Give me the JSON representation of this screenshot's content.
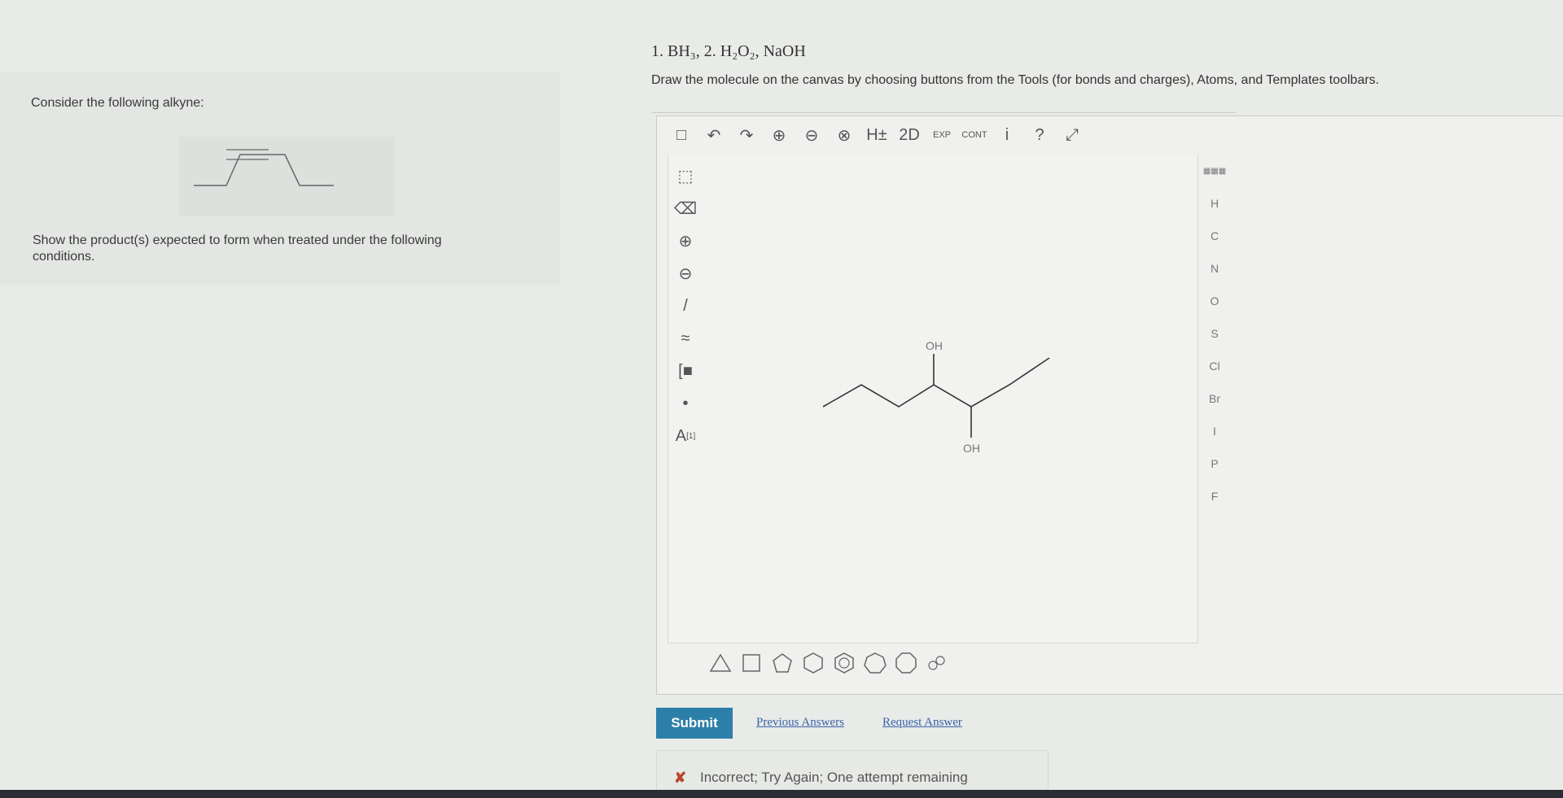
{
  "problem": {
    "consider_label": "Consider the following alkyne:",
    "show_label": "Show the product(s) expected to form when treated under the following conditions."
  },
  "reagents": "1. BH₃, 2. H₂O₂, NaOH",
  "instructions": "Draw the molecule on the canvas by choosing buttons from the Tools (for bonds and charges), Atoms, and Templates toolbars.",
  "editor": {
    "top_toolbar": [
      {
        "icon": "new-document-icon",
        "glyph": "□"
      },
      {
        "icon": "undo-icon",
        "glyph": "↶"
      },
      {
        "icon": "redo-icon",
        "glyph": "↷"
      },
      {
        "icon": "zoom-in-icon",
        "glyph": "⊕"
      },
      {
        "icon": "zoom-out-icon",
        "glyph": "⊖"
      },
      {
        "icon": "zoom-reset-icon",
        "glyph": "⊗"
      },
      {
        "icon": "hydrogen-toggle-icon",
        "glyph": "H±"
      },
      {
        "icon": "2d-clean-icon",
        "glyph": "2D"
      },
      {
        "icon": "expand-icon",
        "glyph": "EXP"
      },
      {
        "icon": "contract-icon",
        "glyph": "CONT"
      },
      {
        "icon": "info-icon",
        "glyph": "i"
      },
      {
        "icon": "help-icon",
        "glyph": "?"
      },
      {
        "icon": "fullscreen-icon",
        "glyph": "⤢"
      }
    ],
    "left_toolbar": [
      {
        "icon": "select-tool-icon",
        "glyph": "⬚"
      },
      {
        "icon": "eraser-icon",
        "glyph": "⌫"
      },
      {
        "icon": "positive-charge-icon",
        "glyph": "⊕"
      },
      {
        "icon": "negative-charge-icon",
        "glyph": "⊖"
      },
      {
        "icon": "single-bond-icon",
        "glyph": "/"
      },
      {
        "icon": "chain-tool-icon",
        "glyph": "≈"
      },
      {
        "icon": "bracket-tool-icon",
        "glyph": "[■"
      },
      {
        "icon": "radical-icon",
        "glyph": "•"
      },
      {
        "icon": "atom-label-icon",
        "glyph": "A"
      }
    ],
    "atom_label_tool_superscript": "[1]",
    "atoms": [
      "H",
      "C",
      "N",
      "O",
      "S",
      "Cl",
      "Br",
      "I",
      "P",
      "F"
    ],
    "periodic_table_icon": "periodic-table-icon",
    "molecule_labels": {
      "oh_top": "OH",
      "oh_bottom": "OH"
    },
    "templates": [
      "triangle",
      "square",
      "pentagon",
      "hexagon",
      "hexagon-aromatic",
      "heptagon",
      "octagon",
      "template-more"
    ]
  },
  "submit_label": "Submit",
  "links": {
    "previous": "Previous Answers",
    "request": "Request Answer"
  },
  "feedback": "Incorrect; Try Again; One attempt remaining",
  "colors": {
    "submit": "#2c7fa8",
    "link": "#3a63a8",
    "error": "#b8452a"
  }
}
